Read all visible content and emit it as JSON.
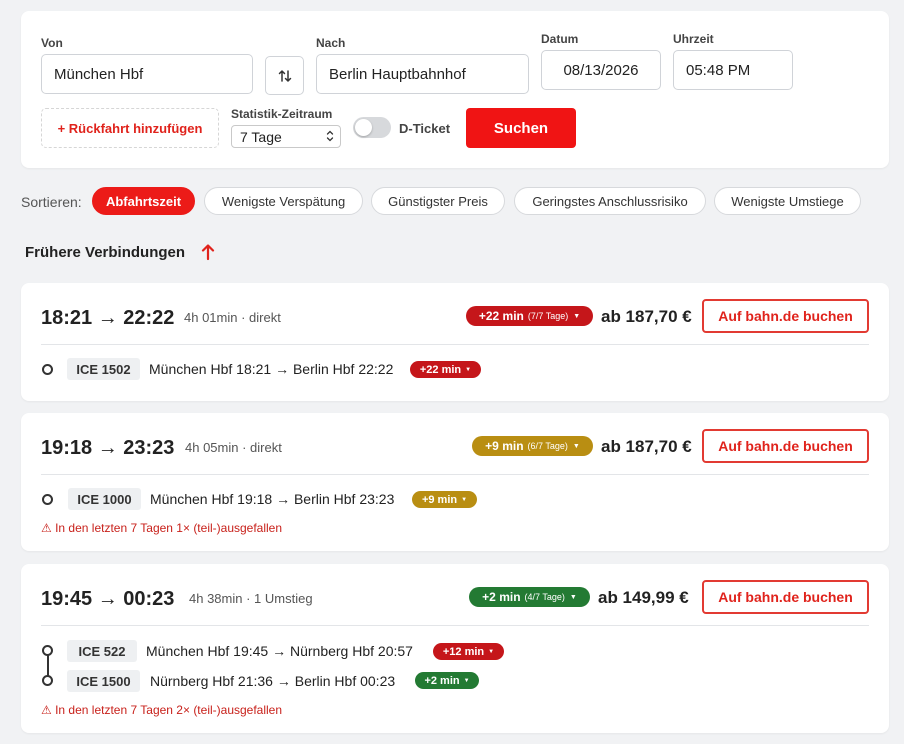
{
  "search": {
    "von_label": "Von",
    "von_value": "München Hbf",
    "nach_label": "Nach",
    "nach_value": "Berlin Hauptbahnhof",
    "datum_label": "Datum",
    "datum_value": "08/13/2026",
    "uhrzeit_label": "Uhrzeit",
    "uhrzeit_value": "05:48 PM",
    "rueckfahrt_label": "+ Rückfahrt hinzufügen",
    "statistik_label": "Statistik-Zeitraum",
    "statistik_value": "7 Tage",
    "dticket_label": "D-Ticket",
    "dticket_on": false,
    "suchen_label": "Suchen"
  },
  "sort": {
    "label": "Sortieren:",
    "options": [
      {
        "label": "Abfahrtszeit",
        "active": true
      },
      {
        "label": "Wenigste Verspätung",
        "active": false
      },
      {
        "label": "Günstigster Preis",
        "active": false
      },
      {
        "label": "Geringstes Anschlussrisiko",
        "active": false
      },
      {
        "label": "Wenigste Umstiege",
        "active": false
      }
    ]
  },
  "earlier_label": "Frühere Verbindungen",
  "book_label": "Auf bahn.de buchen",
  "colors": {
    "accent": "#ec1b18",
    "delay_red": "#c5161a",
    "delay_gold": "#b98e12",
    "delay_green": "#237a33",
    "warning": "#c8211b"
  },
  "connections": [
    {
      "times": "18:21 → 22:22",
      "meta": "4h 01min · direkt",
      "delay": "+22 min",
      "delay_days": "(7/7 Tage)",
      "delay_color": "red",
      "price": "ab 187,70 €",
      "legs": [
        {
          "train": "ICE 1502",
          "route": "München Hbf 18:21 → Berlin Hbf 22:22",
          "delay": "+22 min",
          "color": "red"
        }
      ],
      "warning": ""
    },
    {
      "times": "19:18 → 23:23",
      "meta": "4h 05min · direkt",
      "delay": "+9 min",
      "delay_days": "(6/7 Tage)",
      "delay_color": "gold",
      "price": "ab 187,70 €",
      "legs": [
        {
          "train": "ICE 1000",
          "route": "München Hbf 19:18 → Berlin Hbf 23:23",
          "delay": "+9 min",
          "color": "gold"
        }
      ],
      "warning": "⚠ In den letzten 7 Tagen 1× (teil-)ausgefallen"
    },
    {
      "times": "19:45 → 00:23",
      "meta": "4h 38min · 1 Umstieg",
      "delay": "+2 min",
      "delay_days": "(4/7 Tage)",
      "delay_color": "green",
      "price": "ab 149,99 €",
      "legs": [
        {
          "train": "ICE 522",
          "route": "München Hbf 19:45 → Nürnberg Hbf 20:57",
          "delay": "+12 min",
          "color": "red"
        },
        {
          "train": "ICE 1500",
          "route": "Nürnberg Hbf 21:36 → Berlin Hbf 00:23",
          "delay": "+2 min",
          "color": "green"
        }
      ],
      "warning": "⚠ In den letzten 7 Tagen 2× (teil-)ausgefallen"
    }
  ]
}
